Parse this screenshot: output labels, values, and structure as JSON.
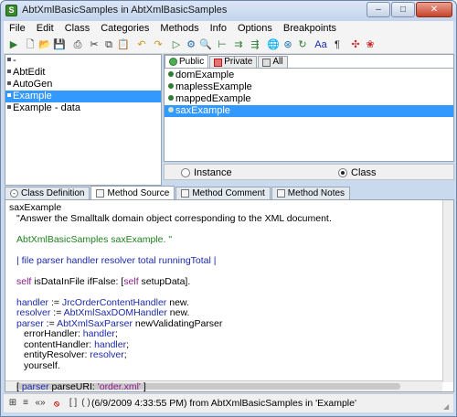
{
  "window": {
    "title": "AbtXmlBasicSamples in AbtXmlBasicSamples",
    "app_icon_glyph": "S",
    "minimize": "–",
    "maximize": "□",
    "close": "✕"
  },
  "menu": [
    "File",
    "Edit",
    "Class",
    "Categories",
    "Methods",
    "Info",
    "Options",
    "Breakpoints"
  ],
  "toolbar": {
    "icons": [
      {
        "name": "run-icon",
        "glyph": "▶",
        "color": "#2e7d32"
      },
      {
        "name": "new-icon",
        "glyph": "🗋",
        "color": "#333"
      },
      {
        "name": "open-icon",
        "glyph": "📂",
        "color": "#c79a1e"
      },
      {
        "name": "save-icon",
        "glyph": "💾",
        "color": "#333"
      },
      {
        "name": "print-icon",
        "glyph": "⎙",
        "color": "#333"
      },
      {
        "name": "cut-icon",
        "glyph": "✂",
        "color": "#333"
      },
      {
        "name": "copy-icon",
        "glyph": "⧉",
        "color": "#333"
      },
      {
        "name": "paste-icon",
        "glyph": "📋",
        "color": "#333"
      },
      {
        "name": "undo-icon",
        "glyph": "↶",
        "color": "#c79a1e"
      },
      {
        "name": "redo-icon",
        "glyph": "↷",
        "color": "#c79a1e"
      },
      {
        "name": "execute-icon",
        "glyph": "▷",
        "color": "#2e7d32"
      },
      {
        "name": "debug-icon",
        "glyph": "⚙",
        "color": "#1c6ab0"
      },
      {
        "name": "inspect-icon",
        "glyph": "🔍",
        "color": "#333"
      },
      {
        "name": "hierarchy-icon",
        "glyph": "⊢",
        "color": "#2e7d32"
      },
      {
        "name": "senders-icon",
        "glyph": "⇉",
        "color": "#2e7d32"
      },
      {
        "name": "implementors-icon",
        "glyph": "⇶",
        "color": "#2e7d32"
      },
      {
        "name": "globe-icon",
        "glyph": "🌐",
        "color": "#1c6ab0"
      },
      {
        "name": "references-icon",
        "glyph": "⊛",
        "color": "#1c6ab0"
      },
      {
        "name": "refresh-icon",
        "glyph": "↻",
        "color": "#2e7d32"
      },
      {
        "name": "font-icon",
        "glyph": "Aa",
        "color": "#1c2aa8"
      },
      {
        "name": "spell-icon",
        "glyph": "¶",
        "color": "#333"
      },
      {
        "name": "breakpoint-icon",
        "glyph": "✣",
        "color": "#c62828"
      },
      {
        "name": "team-icon",
        "glyph": "❀",
        "color": "#c62828"
      }
    ]
  },
  "class_list": {
    "items": [
      {
        "label": "-",
        "selected": false
      },
      {
        "label": "AbtEdit",
        "selected": false
      },
      {
        "label": "AutoGen",
        "selected": false
      },
      {
        "label": "Example",
        "selected": true
      },
      {
        "label": "Example - data",
        "selected": false
      }
    ]
  },
  "method_tabs": [
    {
      "label": "Public",
      "active": true,
      "icon": "green"
    },
    {
      "label": "Private",
      "active": false,
      "icon": "red"
    },
    {
      "label": "All",
      "active": false,
      "icon": "plain"
    }
  ],
  "methods": [
    {
      "label": "domExample",
      "selected": false
    },
    {
      "label": "maplessExample",
      "selected": false
    },
    {
      "label": "mappedExample",
      "selected": false
    },
    {
      "label": "saxExample",
      "selected": true
    }
  ],
  "scope": {
    "instance": "Instance",
    "class": "Class",
    "selected": "class"
  },
  "bottom_tabs": [
    {
      "label": "Class Definition",
      "active": false
    },
    {
      "label": "Method Source",
      "active": true
    },
    {
      "label": "Method Comment",
      "active": false
    },
    {
      "label": "Method Notes",
      "active": false
    }
  ],
  "source": {
    "lines": [
      {
        "indent": 0,
        "segments": [
          {
            "t": "saxExample",
            "c": ""
          }
        ]
      },
      {
        "indent": 1,
        "segments": [
          {
            "t": "\"Answer the Smalltalk domain object corresponding to the XML document.",
            "c": ""
          }
        ]
      },
      {
        "indent": 0,
        "segments": [
          {
            "t": "",
            "c": ""
          }
        ]
      },
      {
        "indent": 1,
        "segments": [
          {
            "t": "AbtXmlBasicSamples saxExample. \"",
            "c": "green"
          }
        ]
      },
      {
        "indent": 0,
        "segments": [
          {
            "t": "",
            "c": ""
          }
        ]
      },
      {
        "indent": 1,
        "segments": [
          {
            "t": "| file parser handler resolver total runningTotal |",
            "c": "blue"
          }
        ]
      },
      {
        "indent": 0,
        "segments": [
          {
            "t": "",
            "c": ""
          }
        ]
      },
      {
        "indent": 1,
        "segments": [
          {
            "t": "self",
            "c": "purple"
          },
          {
            "t": " isDataInFile ifFalse: [",
            "c": ""
          },
          {
            "t": "self",
            "c": "purple"
          },
          {
            "t": " setupData].",
            "c": ""
          }
        ]
      },
      {
        "indent": 0,
        "segments": [
          {
            "t": "",
            "c": ""
          }
        ]
      },
      {
        "indent": 1,
        "segments": [
          {
            "t": "handler",
            "c": "blue"
          },
          {
            "t": " := ",
            "c": ""
          },
          {
            "t": "JrcOrderContentHandler",
            "c": "blue"
          },
          {
            "t": " new.",
            "c": ""
          }
        ]
      },
      {
        "indent": 1,
        "segments": [
          {
            "t": "resolver",
            "c": "blue"
          },
          {
            "t": " := ",
            "c": ""
          },
          {
            "t": "AbtXmlSaxDOMHandler",
            "c": "blue"
          },
          {
            "t": " new.",
            "c": ""
          }
        ]
      },
      {
        "indent": 1,
        "segments": [
          {
            "t": "parser",
            "c": "blue"
          },
          {
            "t": " := ",
            "c": ""
          },
          {
            "t": "AbtXmlSaxParser",
            "c": "blue"
          },
          {
            "t": " newValidatingParser",
            "c": ""
          }
        ]
      },
      {
        "indent": 2,
        "segments": [
          {
            "t": "errorHandler: ",
            "c": ""
          },
          {
            "t": "handler",
            "c": "blue"
          },
          {
            "t": ";",
            "c": ""
          }
        ]
      },
      {
        "indent": 2,
        "segments": [
          {
            "t": "contentHandler: ",
            "c": ""
          },
          {
            "t": "handler",
            "c": "blue"
          },
          {
            "t": ";",
            "c": ""
          }
        ]
      },
      {
        "indent": 2,
        "segments": [
          {
            "t": "entityResolver: ",
            "c": ""
          },
          {
            "t": "resolver",
            "c": "blue"
          },
          {
            "t": ";",
            "c": ""
          }
        ]
      },
      {
        "indent": 2,
        "segments": [
          {
            "t": "yourself.",
            "c": ""
          }
        ]
      },
      {
        "indent": 0,
        "segments": [
          {
            "t": "",
            "c": ""
          }
        ]
      },
      {
        "indent": 1,
        "segments": [
          {
            "t": "[ ",
            "c": ""
          },
          {
            "t": "parser",
            "c": "blue"
          },
          {
            "t": " parseURI: ",
            "c": ""
          },
          {
            "t": "'order.xml'",
            "c": "purple"
          },
          {
            "t": " ]",
            "c": ""
          }
        ]
      }
    ]
  },
  "statusbar": {
    "text": "(6/9/2009 4:33:55 PM) from AbtXmlBasicSamples in 'Example'",
    "icons": [
      {
        "name": "class-list-icon",
        "glyph": "⊞"
      },
      {
        "name": "lines-icon",
        "glyph": "≡"
      },
      {
        "name": "back-icon",
        "glyph": "«»"
      },
      {
        "name": "stop-icon",
        "glyph": "⦸"
      },
      {
        "name": "brackets-icon",
        "glyph": "[ ]"
      },
      {
        "name": "parens-icon",
        "glyph": "( )"
      }
    ]
  }
}
